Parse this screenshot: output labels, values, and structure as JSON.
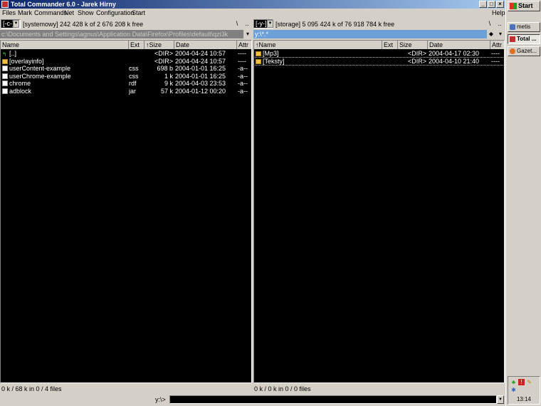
{
  "window": {
    "title": "Total Commander 6.0 - Jarek Hirny",
    "controls": [
      "_",
      "□",
      "×"
    ]
  },
  "menu": {
    "items": [
      "Files",
      "Mark",
      "Commands",
      "Net",
      "Show",
      "Configuration",
      "Start"
    ],
    "help": "Help"
  },
  "left": {
    "drive": "[-c-]",
    "drive_info": "[systemowy]  242 428 k of 2 676 208 k free",
    "root_btn": "\\",
    "up_btn": "..",
    "path": "c:\\Documents and Settings\\agnus\\Application Data\\Firefox\\Profiles\\default\\qzi3k",
    "path_btn": "▾",
    "columns": {
      "name": "Name",
      "ext": "Ext",
      "size": "↑Size",
      "date": "Date",
      "attr": "Attr"
    },
    "files": [
      {
        "icon": "up",
        "name": "[..]",
        "ext": "",
        "size": "<DIR>",
        "date": "2004-04-24 10:57",
        "attr": "----"
      },
      {
        "icon": "folder",
        "name": "[overlayinfo]",
        "ext": "",
        "size": "<DIR>",
        "date": "2004-04-24 10:57",
        "attr": "----"
      },
      {
        "icon": "file",
        "name": "userContent-example",
        "ext": "css",
        "size": "698 b",
        "date": "2004-01-01 16:25",
        "attr": "-a--"
      },
      {
        "icon": "file",
        "name": "userChrome-example",
        "ext": "css",
        "size": "1 k",
        "date": "2004-01-01 16:25",
        "attr": "-a--"
      },
      {
        "icon": "file",
        "name": "chrome",
        "ext": "rdf",
        "size": "9 k",
        "date": "2004-04-03 23:53",
        "attr": "-a--"
      },
      {
        "icon": "file",
        "name": "adblock",
        "ext": "jar",
        "size": "57 k",
        "date": "2004-01-12 00:20",
        "attr": "-a--"
      }
    ],
    "status": "0 k / 68 k in 0 / 4 files"
  },
  "right": {
    "drive": "[-y-]",
    "drive_info": "[storage]  5 095 424 k of 76 918 784 k free",
    "root_btn": "\\",
    "up_btn": "..",
    "path": "y:\\*.*",
    "path_btn": "▾",
    "columns": {
      "name": "↑Name",
      "ext": "Ext",
      "size": "Size",
      "date": "Date",
      "attr": "Attr"
    },
    "files": [
      {
        "icon": "folder",
        "name": "[Mp3]",
        "ext": "",
        "size": "<DIR>",
        "date": "2004-04-17 02:30",
        "attr": "----"
      },
      {
        "icon": "folder",
        "name": "[Teksty]",
        "ext": "",
        "size": "<DIR>",
        "date": "2004-04-10 21:40",
        "attr": "----"
      }
    ],
    "status": "0 k / 0 k in 0 / 0 files"
  },
  "command": {
    "label": "y:\\>",
    "value": ""
  },
  "taskbar": {
    "start": "Start",
    "tasks": [
      {
        "label": "metis",
        "active": false
      },
      {
        "label": "Total ...",
        "active": true
      },
      {
        "label": "Gazet...",
        "active": false
      }
    ],
    "clock": "13:14"
  }
}
